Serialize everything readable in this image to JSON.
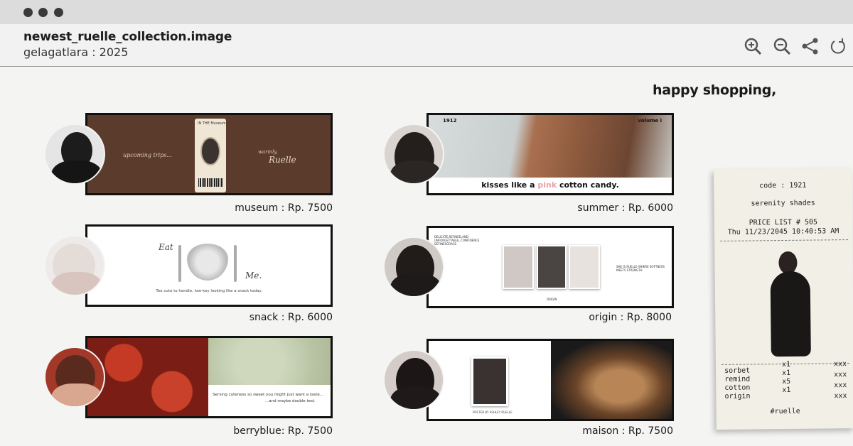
{
  "window": {
    "filename": "newest_ruelle_collection.image",
    "subtitle": "gelagatlara : 2025"
  },
  "toolbar": {
    "icons": [
      "zoom-in-icon",
      "zoom-out-icon",
      "share-icon",
      "refresh-icon"
    ]
  },
  "tagline": "happy shopping,",
  "products": {
    "museum": {
      "price": "museum : Rp. 7500",
      "banner_text_left": "upcoming trips...",
      "banner_text_right_small": "warmly,",
      "banner_text_right": "Ruelle",
      "ticket_text": "IN THE Museum"
    },
    "summer": {
      "price": "summer : Rp. 6000",
      "caption_before": "kisses like a ",
      "caption_highlight": "pink",
      "caption_after": " cotton candy.",
      "number": "1912",
      "volume": "volume i"
    },
    "snack": {
      "price": "snack : Rp. 6000",
      "eat": "Eat",
      "me": "Me.",
      "caption": "Too cute to handle, low-key looking like a snack today."
    },
    "origin": {
      "price": "origin : Rp. 8000",
      "text_top": "DELICATE,REFINED,AND UNFORGETTABLE, CONFIDENCE DEFINESGRACE.",
      "text_right": "SHE IS RUELLE WHERE SOFTNESS MEETS STRENGTH",
      "text_bottom": "ORIGIN"
    },
    "berryblue": {
      "price": "berryblue: Rp. 7500",
      "caption1": "Serving cuteness so sweet you might just want a taste...",
      "caption2": "...and maybe double test."
    },
    "maison": {
      "price": "maison : Rp. 7500",
      "caption": "POSTED BY ASHLEY RUELLE"
    }
  },
  "receipt": {
    "code": "code : 1921",
    "name": "serenity shades",
    "price_list": "PRICE LIST # 505",
    "datetime": "Thu 11/23/2045 10:40:53 AM",
    "items": [
      {
        "name": "sorbet",
        "qty": "x1",
        "price": "xxx"
      },
      {
        "name": "remind",
        "qty": "x1",
        "price": "xxx"
      },
      {
        "name": "cotton",
        "qty": "x5",
        "price": "xxx"
      },
      {
        "name": "origin",
        "qty": "x1",
        "price": "xxx"
      }
    ],
    "hashtag": "#ruelle"
  },
  "colors": {
    "museum_bg": "#5b3b2c",
    "accent_pink": "#e6a4a6",
    "page_bg": "#f4f4f2",
    "titlebar": "#dcdcdc"
  }
}
